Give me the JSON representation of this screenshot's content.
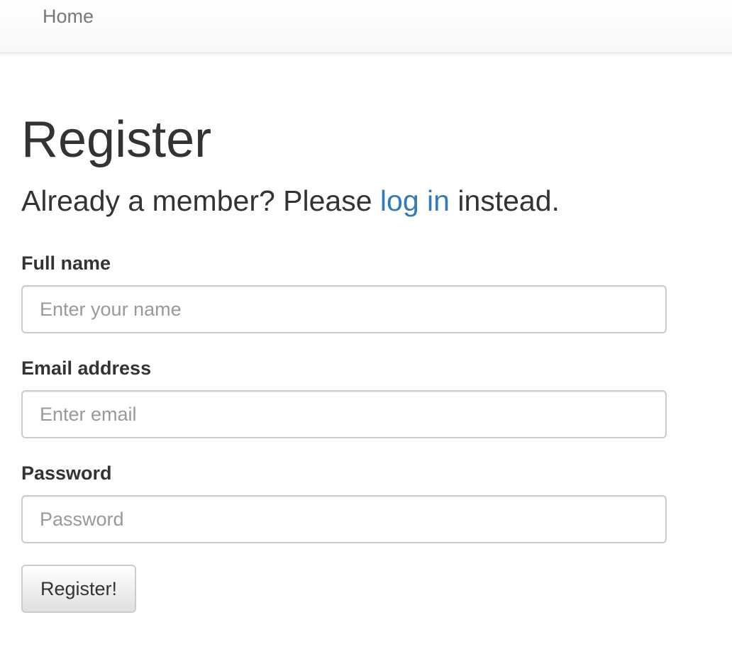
{
  "nav": {
    "home_label": "Home"
  },
  "page": {
    "title": "Register",
    "lead_prefix": "Already a member? Please ",
    "lead_link": "log in",
    "lead_suffix": " instead."
  },
  "form": {
    "fields": [
      {
        "label": "Full name",
        "placeholder": "Enter your name",
        "value": ""
      },
      {
        "label": "Email address",
        "placeholder": "Enter email",
        "value": ""
      },
      {
        "label": "Password",
        "placeholder": "Password",
        "value": ""
      }
    ],
    "submit_label": "Register!"
  },
  "colors": {
    "link": "#337ab7",
    "text": "#333333",
    "muted": "#777777",
    "placeholder": "#999999",
    "border": "#cccccc"
  }
}
